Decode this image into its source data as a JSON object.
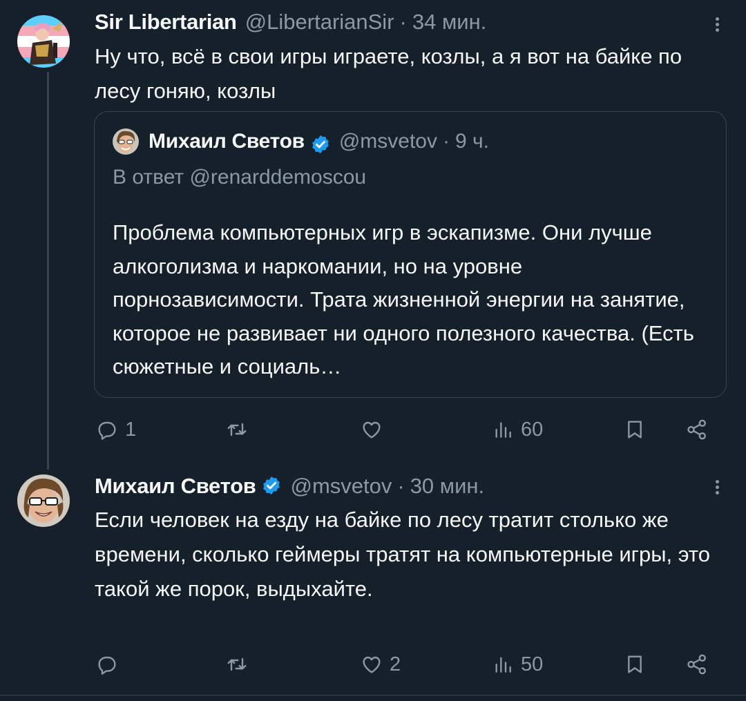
{
  "tweets": [
    {
      "author": "Sir Libertarian",
      "handle": "@LibertarianSir",
      "separator": "·",
      "time": "34 мин.",
      "text": "Ну что, всё в свои игры играете, козлы, а я вот на байке по лесу гоняю, козлы",
      "quoted": {
        "author": "Михаил Светов",
        "handle": "@msvetov",
        "separator": "·",
        "time": "9 ч.",
        "reply_to": "В ответ @renarddemoscou",
        "text": "Проблема компьютерных игр в эскапизме. Они лучше алкоголизма и наркомании, но на уровне порнозависимости. Трата жизненной энергии на занятие, которое не развивает ни одного полезного качества. (Есть сюжетные и социаль…"
      },
      "actions": {
        "replies": "1",
        "retweets": "",
        "likes": "",
        "views": "60"
      }
    },
    {
      "author": "Михаил Светов",
      "handle": "@msvetov",
      "separator": "·",
      "time": "30 мин.",
      "text": "Если человек на езду на байке по лесу тратит столько же времени, сколько геймеры тратят на компьютерные игры, это такой же порок, выдыхайте.",
      "actions": {
        "replies": "",
        "retweets": "",
        "likes": "2",
        "views": "50"
      }
    }
  ],
  "icons": {
    "reply": "reply-icon",
    "retweet": "retweet-icon",
    "like": "heart-icon",
    "views": "views-icon",
    "bookmark": "bookmark-icon",
    "share": "share-icon",
    "verified": "verified-badge-icon",
    "more": "more-options-icon"
  },
  "colors": {
    "background": "#15202b",
    "text": "#f7f9f9",
    "muted": "#8b98a5",
    "border": "#38444d",
    "verified": "#1d9bf0"
  }
}
